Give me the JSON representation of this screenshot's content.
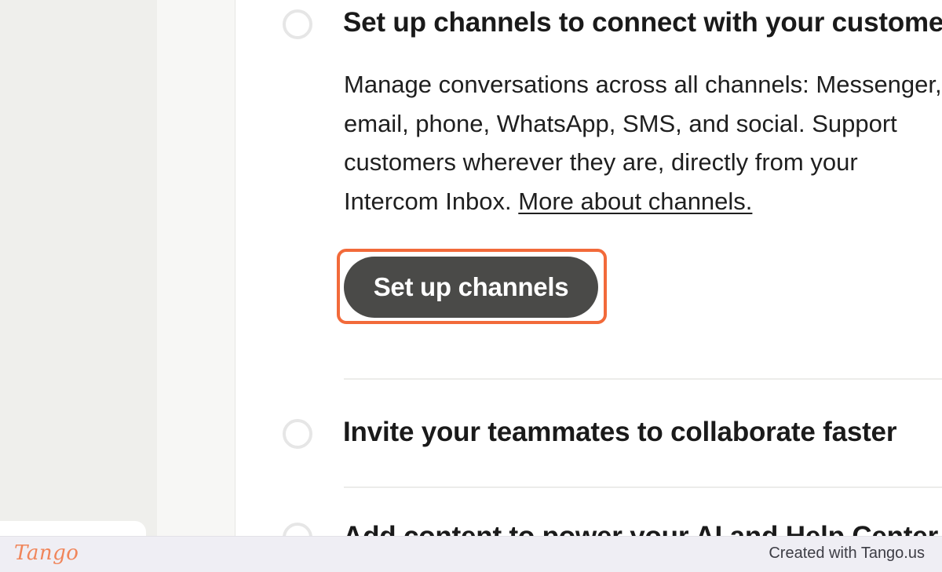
{
  "step1": {
    "title": "Set up channels to connect with your customers",
    "description_lines": [
      "Manage conversations across all channels: Messenger,",
      "email, phone, WhatsApp, SMS, and social. Support",
      "customers wherever they are, directly from your",
      "Intercom Inbox."
    ],
    "link_text": "More about channels.",
    "button_label": "Set up channels"
  },
  "step2": {
    "title": "Invite your teammates to collaborate faster"
  },
  "step3": {
    "title": "Add content to power your AI and Help Center"
  },
  "footer": {
    "logo_text": "Tango",
    "credit": "Created with Tango.us"
  },
  "colors": {
    "highlight": "#f26a3a",
    "button_bg": "#4a4a48",
    "brand": "#f0855a"
  }
}
